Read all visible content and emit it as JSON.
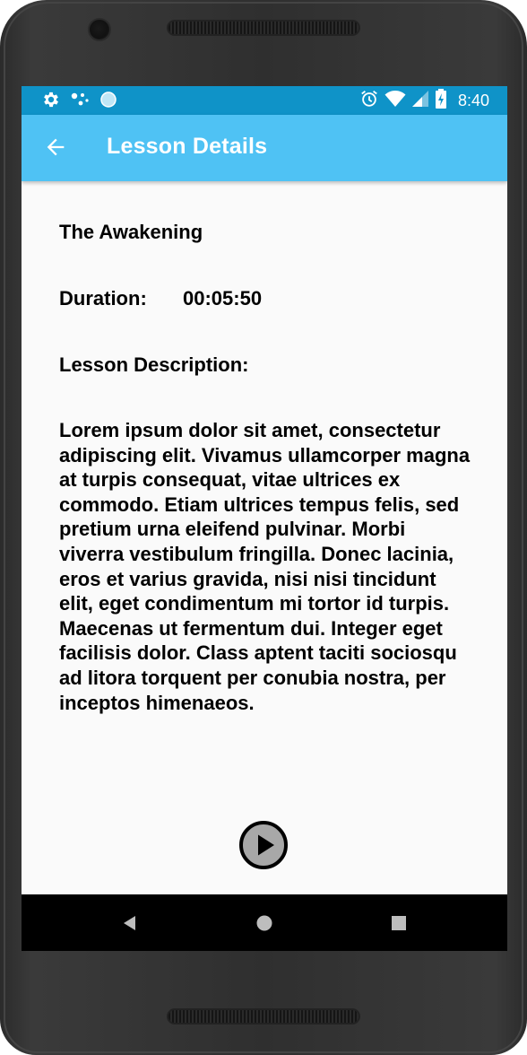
{
  "status_bar": {
    "time": "8:40",
    "left_icons": [
      "settings-icon",
      "dots-icon",
      "circle-icon"
    ],
    "right_icons": [
      "alarm-icon",
      "wifi-icon",
      "signal-icon",
      "battery-icon"
    ],
    "color": "#0f93c8"
  },
  "app_bar": {
    "title": "Lesson Details",
    "back_icon": "arrow-left-icon",
    "color": "#4fc2f4"
  },
  "lesson": {
    "title": "The Awakening",
    "duration_label": "Duration:",
    "duration_value": "00:05:50",
    "description_label": "Lesson Description:",
    "description": "Lorem ipsum dolor sit amet, consectetur adipiscing elit. Vivamus ullamcorper magna at turpis consequat, vitae ultrices ex commodo. Etiam ultrices tempus felis, sed pretium urna eleifend pulvinar. Morbi viverra vestibulum fringilla. Donec lacinia, eros et varius gravida, nisi nisi tincidunt elit, eget condimentum mi tortor id turpis. Maecenas ut fermentum dui. Integer eget facilisis dolor. Class aptent taciti sociosqu ad litora torquent per conubia nostra, per inceptos himenaeos."
  },
  "player": {
    "play_icon": "play-icon"
  },
  "nav_bar": {
    "icons": [
      "back-triangle-icon",
      "home-circle-icon",
      "recents-square-icon"
    ]
  }
}
